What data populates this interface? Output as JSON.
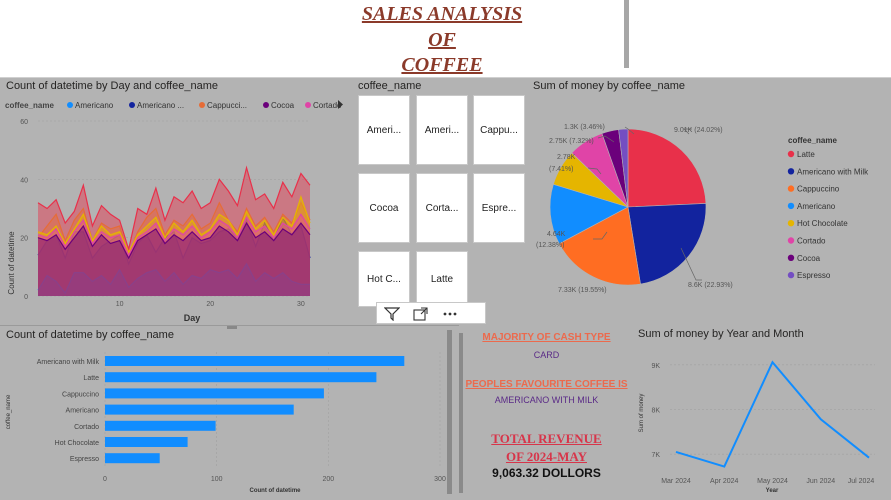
{
  "header": {
    "title_line1": "SALES ANALYSIS",
    "title_line2": "OF",
    "title_line3": "COFFEE"
  },
  "area_chart": {
    "title": "Count of datetime by Day and coffee_name",
    "legend_label": "coffee_name",
    "legend": [
      {
        "name": "Americano",
        "color": "#118dff"
      },
      {
        "name": "Americano ...",
        "color": "#12239e"
      },
      {
        "name": "Cappucci...",
        "color": "#e66c37"
      },
      {
        "name": "Cocoa",
        "color": "#6b007b"
      },
      {
        "name": "Cortado",
        "color": "#e044a7"
      }
    ],
    "legend_more_icon": "chevron-right-icon",
    "xlabel": "Day",
    "ylabel": "Count of datetime",
    "x_ticks": [
      "10",
      "20",
      "30"
    ],
    "y_ticks": [
      "0",
      "20",
      "40",
      "60"
    ]
  },
  "slicer": {
    "title": "coffee_name",
    "tiles": [
      "Ameri...",
      "Ameri...",
      "Cappu...",
      "Cocoa",
      "Corta...",
      "Espre...",
      "Hot C...",
      "Latte"
    ],
    "icons": [
      "filter-icon",
      "focus-mode-icon",
      "more-options-icon"
    ]
  },
  "pie_chart": {
    "title": "Sum of money by coffee_name",
    "legend_title": "coffee_name",
    "labels": [
      {
        "text": "9.01K (24.02%)"
      },
      {
        "text": "8.6K (22.93%)"
      },
      {
        "text": "7.33K (19.55%)"
      },
      {
        "text": "4.64K"
      },
      {
        "text": "(12.38%)"
      },
      {
        "text": "2.78K"
      },
      {
        "text": "(7.41%)"
      },
      {
        "text": "2.75K (7.32%)"
      },
      {
        "text": "1.3K (3.46%)"
      }
    ]
  },
  "bar_chart": {
    "title": "Count of datetime by coffee_name",
    "xlabel": "Count of datetime",
    "ylabel": "coffee_name",
    "x_ticks": [
      "0",
      "100",
      "200",
      "300"
    ]
  },
  "kpi": {
    "cash_heading": "MAJORITY OF CASH TYPE",
    "cash_value": "CARD",
    "fav_heading": "PEOPLES FAVOURITE COFFEE IS",
    "fav_value": "AMERICANO WITH MILK",
    "rev_heading_1": "TOTAL REVENUE",
    "rev_heading_2": "OF 2024-MAY",
    "rev_value": "9,063.32 DOLLORS"
  },
  "line_chart": {
    "title": "Sum of money by Year and Month",
    "xlabel": "Year",
    "ylabel": "Sum of money",
    "y_ticks": [
      "7K",
      "8K",
      "9K"
    ]
  },
  "chart_data": [
    {
      "type": "area",
      "title": "Count of datetime by Day and coffee_name",
      "xlabel": "Day",
      "ylabel": "Count of datetime",
      "ylim": [
        0,
        60
      ],
      "x": [
        1,
        2,
        3,
        4,
        5,
        6,
        7,
        8,
        9,
        10,
        11,
        12,
        13,
        14,
        15,
        16,
        17,
        18,
        19,
        20,
        21,
        22,
        23,
        24,
        25,
        26,
        27,
        28,
        29,
        30,
        31
      ],
      "stacked": false,
      "series": [
        {
          "name": "Latte",
          "color": "#e8304a",
          "values": [
            32,
            30,
            33,
            25,
            29,
            38,
            24,
            31,
            28,
            26,
            16,
            30,
            28,
            37,
            26,
            34,
            32,
            36,
            30,
            32,
            40,
            36,
            31,
            44,
            33,
            35,
            30,
            39,
            34,
            42,
            38
          ]
        },
        {
          "name": "Americano with Milk",
          "color": "#12239e",
          "values": [
            14,
            19,
            21,
            13,
            22,
            22,
            13,
            17,
            19,
            21,
            11,
            18,
            21,
            15,
            20,
            22,
            13,
            20,
            18,
            19,
            22,
            23,
            20,
            26,
            17,
            25,
            19,
            27,
            21,
            24,
            13
          ]
        },
        {
          "name": "Cappuccino",
          "color": "#e66c37",
          "values": [
            20,
            24,
            28,
            19,
            26,
            30,
            19,
            25,
            23,
            24,
            14,
            22,
            27,
            30,
            21,
            26,
            24,
            28,
            23,
            25,
            32,
            26,
            22,
            30,
            24,
            27,
            22,
            28,
            25,
            32,
            26
          ]
        },
        {
          "name": "Americano",
          "color": "#118dff",
          "values": [
            2,
            7,
            5,
            1,
            8,
            8,
            5,
            7,
            4,
            9,
            3,
            6,
            8,
            9,
            5,
            8,
            4,
            7,
            6,
            9,
            8,
            9,
            6,
            11,
            5,
            8,
            6,
            8,
            5,
            4,
            4
          ]
        },
        {
          "name": "Hot Chocolate",
          "color": "#e5b500",
          "values": [
            22,
            21,
            24,
            18,
            23,
            28,
            19,
            24,
            21,
            22,
            15,
            21,
            24,
            27,
            20,
            25,
            22,
            26,
            21,
            23,
            28,
            26,
            21,
            29,
            23,
            26,
            21,
            27,
            24,
            34,
            25
          ]
        },
        {
          "name": "Cortado",
          "color": "#e044a7",
          "values": [
            21,
            20,
            23,
            17,
            22,
            26,
            18,
            22,
            20,
            21,
            14,
            20,
            22,
            25,
            19,
            23,
            21,
            24,
            20,
            22,
            26,
            24,
            20,
            27,
            22,
            24,
            20,
            25,
            23,
            28,
            23
          ]
        },
        {
          "name": "Cocoa",
          "color": "#6b007b",
          "values": [
            20,
            19,
            21,
            16,
            20,
            24,
            17,
            21,
            18,
            19,
            13,
            19,
            21,
            23,
            18,
            21,
            19,
            22,
            19,
            20,
            24,
            22,
            19,
            25,
            20,
            22,
            19,
            23,
            21,
            25,
            21
          ]
        }
      ]
    },
    {
      "type": "pie",
      "title": "Sum of money by coffee_name",
      "legend_title": "coffee_name",
      "legend_position": "right",
      "slices": [
        {
          "name": "Latte",
          "value": 9.01,
          "percent": 24.02,
          "color": "#e8304a"
        },
        {
          "name": "Americano with Milk",
          "value": 8.6,
          "percent": 22.93,
          "color": "#12239e"
        },
        {
          "name": "Cappuccino",
          "value": 7.33,
          "percent": 19.55,
          "color": "#ff6d22"
        },
        {
          "name": "Americano",
          "value": 4.64,
          "percent": 12.38,
          "color": "#118dff"
        },
        {
          "name": "Hot Chocolate",
          "value": 2.78,
          "percent": 7.41,
          "color": "#e5b500"
        },
        {
          "name": "Cortado",
          "value": 2.75,
          "percent": 7.32,
          "color": "#e044a7"
        },
        {
          "name": "Cocoa",
          "value": 1.3,
          "percent": 3.46,
          "color": "#6b007b"
        },
        {
          "name": "Espresso",
          "value": 0.7,
          "percent": 1.9,
          "color": "#744ec2"
        }
      ]
    },
    {
      "type": "bar",
      "orientation": "horizontal",
      "title": "Count of datetime by coffee_name",
      "xlabel": "Count of datetime",
      "ylabel": "coffee_name",
      "xlim": [
        0,
        300
      ],
      "color": "#118dff",
      "categories": [
        "Americano with Milk",
        "Latte",
        "Cappuccino",
        "Americano",
        "Cortado",
        "Hot Chocolate",
        "Espresso"
      ],
      "values": [
        268,
        243,
        196,
        169,
        99,
        74,
        49
      ]
    },
    {
      "type": "line",
      "title": "Sum of money by Year and Month",
      "xlabel": "Year",
      "ylabel": "Sum of money",
      "ylim": [
        6.6,
        9.4
      ],
      "color": "#118dff",
      "categories": [
        "Mar 2024",
        "Apr 2024",
        "May 2024",
        "Jun 2024",
        "Jul 2024"
      ],
      "values": [
        7.05,
        6.72,
        9.06,
        7.78,
        6.92
      ]
    }
  ]
}
